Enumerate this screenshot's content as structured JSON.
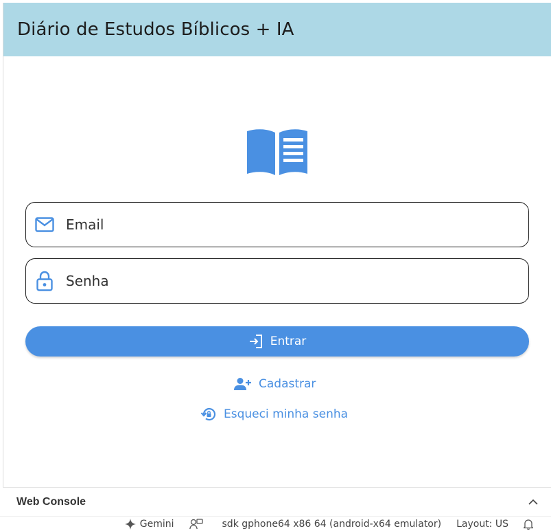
{
  "appbar": {
    "title": "Diário de Estudos Bíblicos + IA"
  },
  "login": {
    "email_placeholder": "Email",
    "senha_placeholder": "Senha",
    "enter_label": "Entrar",
    "register_label": "Cadastrar",
    "forgot_label": "Esqueci minha senha"
  },
  "console": {
    "title": "Web Console"
  },
  "statusbar": {
    "gemini": "Gemini",
    "device": "sdk gphone64 x86 64 (android-x64 emulator)",
    "layout": "Layout: US"
  },
  "colors": {
    "accent": "#4a90e2",
    "appbar": "#add8e6"
  },
  "icons": [
    "book-icon",
    "mail-icon",
    "lock-icon",
    "login-icon",
    "person-add-icon",
    "lock-reset-icon",
    "chevron-up-icon",
    "sparkle-icon",
    "feedback-icon",
    "bell-icon"
  ]
}
